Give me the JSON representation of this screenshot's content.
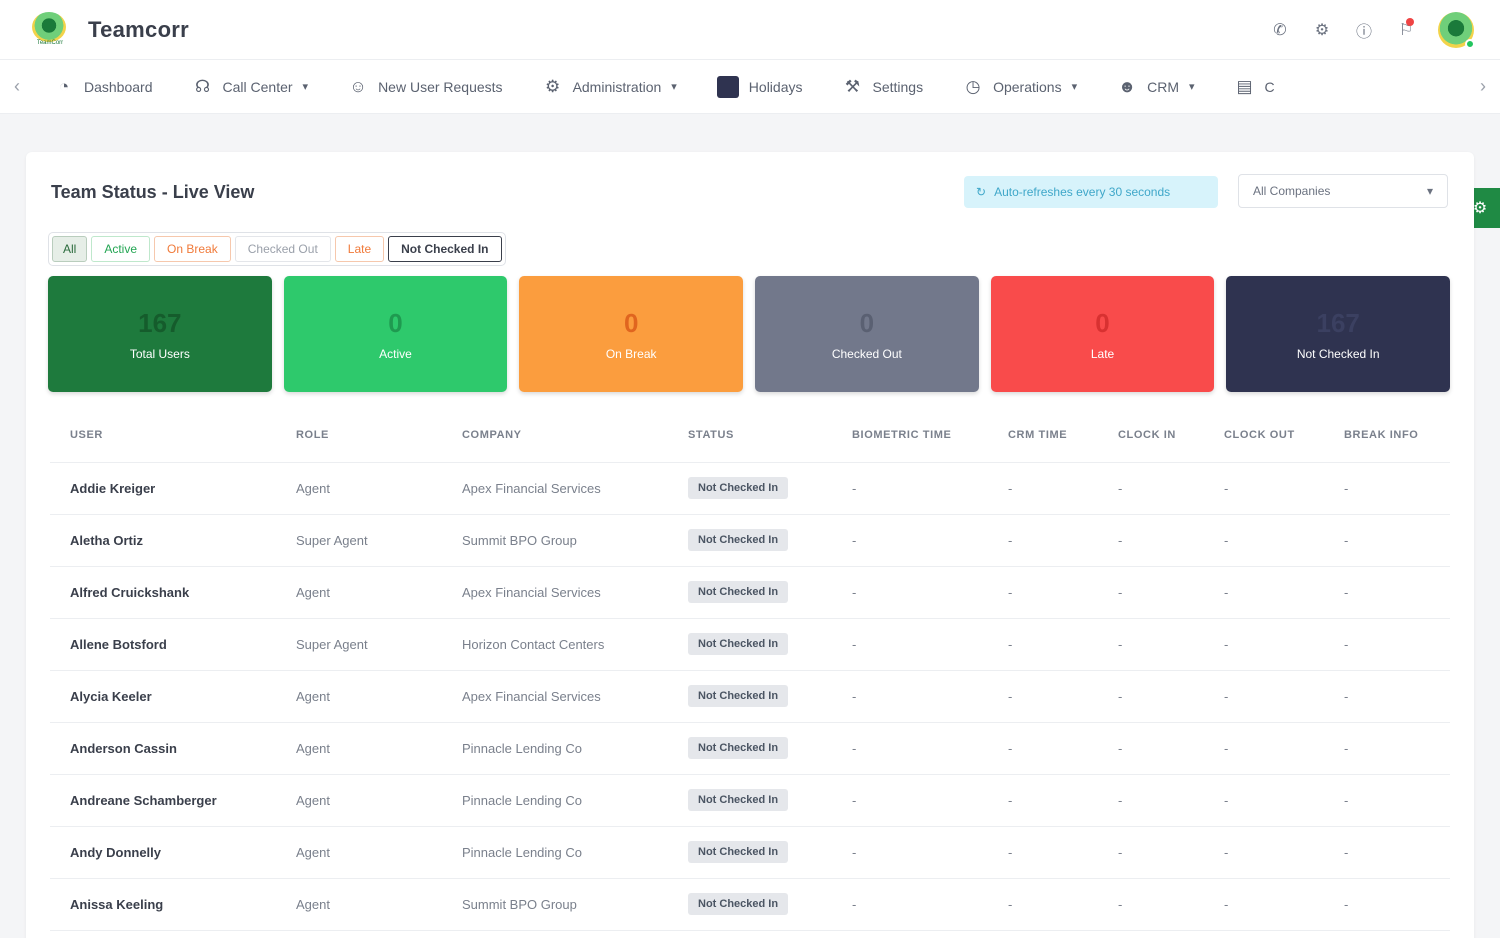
{
  "app": {
    "brand": "Teamcorr",
    "logo_caption": "TeamCorr"
  },
  "topbar": {
    "icons": [
      "phone-icon",
      "gear-icon",
      "help-icon",
      "bell-icon"
    ]
  },
  "nav": {
    "items": [
      {
        "label": "Dashboard",
        "icon": "dashboard-icon",
        "dropdown": false
      },
      {
        "label": "Call Center",
        "icon": "headset-icon",
        "dropdown": true
      },
      {
        "label": "New User Requests",
        "icon": "user-icon",
        "dropdown": false
      },
      {
        "label": "Administration",
        "icon": "gear-icon",
        "dropdown": true
      },
      {
        "label": "Holidays",
        "icon": "calendar-icon",
        "dropdown": false
      },
      {
        "label": "Settings",
        "icon": "settings-icon",
        "dropdown": false
      },
      {
        "label": "Operations",
        "icon": "operations-icon",
        "dropdown": true
      },
      {
        "label": "CRM",
        "icon": "crm-icon",
        "dropdown": true
      },
      {
        "label": "C",
        "icon": "document-icon",
        "dropdown": false
      }
    ]
  },
  "card": {
    "title": "Team Status - Live View",
    "refresh_text": "Auto-refreshes every 30 seconds",
    "company_select": "All Companies"
  },
  "filters": [
    "All",
    "Active",
    "On Break",
    "Checked Out",
    "Late",
    "Not Checked In"
  ],
  "stats": [
    {
      "value": "167",
      "label": "Total Users",
      "color": "#1e7a3d",
      "numColor": "#155c2c"
    },
    {
      "value": "0",
      "label": "Active",
      "color": "#2ec96c",
      "numColor": "#1f9a50"
    },
    {
      "value": "0",
      "label": "On Break",
      "color": "#fb9d3e",
      "numColor": "#e0651f"
    },
    {
      "value": "0",
      "label": "Checked Out",
      "color": "#72788b",
      "numColor": "#5a6072"
    },
    {
      "value": "0",
      "label": "Late",
      "color": "#f94b4b",
      "numColor": "#d83131"
    },
    {
      "value": "167",
      "label": "Not Checked In",
      "color": "#2f3350",
      "numColor": "#3b4061"
    }
  ],
  "table": {
    "headers": [
      "USER",
      "ROLE",
      "COMPANY",
      "STATUS",
      "BIOMETRIC TIME",
      "CRM TIME",
      "CLOCK IN",
      "CLOCK OUT",
      "BREAK INFO"
    ],
    "rows": [
      {
        "user": "Addie Kreiger",
        "role": "Agent",
        "company": "Apex Financial Services",
        "status": "Not Checked In",
        "bio": "-",
        "crm": "-",
        "in": "-",
        "out": "-",
        "brk": "-"
      },
      {
        "user": "Aletha Ortiz",
        "role": "Super Agent",
        "company": "Summit BPO Group",
        "status": "Not Checked In",
        "bio": "-",
        "crm": "-",
        "in": "-",
        "out": "-",
        "brk": "-"
      },
      {
        "user": "Alfred Cruickshank",
        "role": "Agent",
        "company": "Apex Financial Services",
        "status": "Not Checked In",
        "bio": "-",
        "crm": "-",
        "in": "-",
        "out": "-",
        "brk": "-"
      },
      {
        "user": "Allene Botsford",
        "role": "Super Agent",
        "company": "Horizon Contact Centers",
        "status": "Not Checked In",
        "bio": "-",
        "crm": "-",
        "in": "-",
        "out": "-",
        "brk": "-"
      },
      {
        "user": "Alycia Keeler",
        "role": "Agent",
        "company": "Apex Financial Services",
        "status": "Not Checked In",
        "bio": "-",
        "crm": "-",
        "in": "-",
        "out": "-",
        "brk": "-"
      },
      {
        "user": "Anderson Cassin",
        "role": "Agent",
        "company": "Pinnacle Lending Co",
        "status": "Not Checked In",
        "bio": "-",
        "crm": "-",
        "in": "-",
        "out": "-",
        "brk": "-"
      },
      {
        "user": "Andreane Schamberger",
        "role": "Agent",
        "company": "Pinnacle Lending Co",
        "status": "Not Checked In",
        "bio": "-",
        "crm": "-",
        "in": "-",
        "out": "-",
        "brk": "-"
      },
      {
        "user": "Andy Donnelly",
        "role": "Agent",
        "company": "Pinnacle Lending Co",
        "status": "Not Checked In",
        "bio": "-",
        "crm": "-",
        "in": "-",
        "out": "-",
        "brk": "-"
      },
      {
        "user": "Anissa Keeling",
        "role": "Agent",
        "company": "Summit BPO Group",
        "status": "Not Checked In",
        "bio": "-",
        "crm": "-",
        "in": "-",
        "out": "-",
        "brk": "-"
      }
    ]
  }
}
